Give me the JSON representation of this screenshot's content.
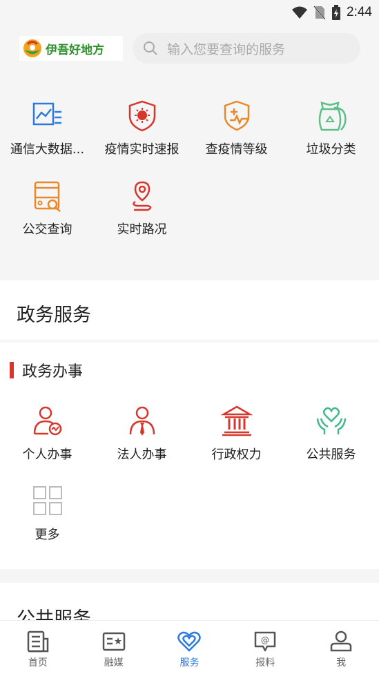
{
  "status_bar": {
    "time": "2:44"
  },
  "header": {
    "logo_text": "伊吾好地方",
    "search_placeholder": "输入您要查询的服务"
  },
  "quick_services": [
    {
      "label": "通信大数据...",
      "icon": "data-chart-icon"
    },
    {
      "label": "疫情实时速报",
      "icon": "virus-shield-icon"
    },
    {
      "label": "查疫情等级",
      "icon": "medical-shield-icon"
    },
    {
      "label": "垃圾分类",
      "icon": "recycle-bag-icon"
    },
    {
      "label": "公交查询",
      "icon": "bus-search-icon"
    },
    {
      "label": "实时路况",
      "icon": "location-pin-icon"
    }
  ],
  "gov_section": {
    "title": "政务服务",
    "subtitle": "政务办事",
    "items": [
      {
        "label": "个人办事",
        "icon": "person-icon"
      },
      {
        "label": "法人办事",
        "icon": "legal-person-icon"
      },
      {
        "label": "行政权力",
        "icon": "government-building-icon"
      },
      {
        "label": "公共服务",
        "icon": "heart-hands-icon"
      },
      {
        "label": "更多",
        "icon": "grid-more-icon"
      }
    ]
  },
  "public_section": {
    "title": "公共服务"
  },
  "bottom_nav": [
    {
      "label": "首页",
      "icon": "home-doc-icon",
      "active": false
    },
    {
      "label": "融媒",
      "icon": "media-card-icon",
      "active": false
    },
    {
      "label": "服务",
      "icon": "heart-service-icon",
      "active": true
    },
    {
      "label": "报料",
      "icon": "report-chat-icon",
      "active": false
    },
    {
      "label": "我",
      "icon": "user-icon",
      "active": false
    }
  ],
  "colors": {
    "accent_blue": "#2b7bdc",
    "accent_red": "#d6362b",
    "orange": "#e8892a",
    "green": "#5cbf8a"
  }
}
